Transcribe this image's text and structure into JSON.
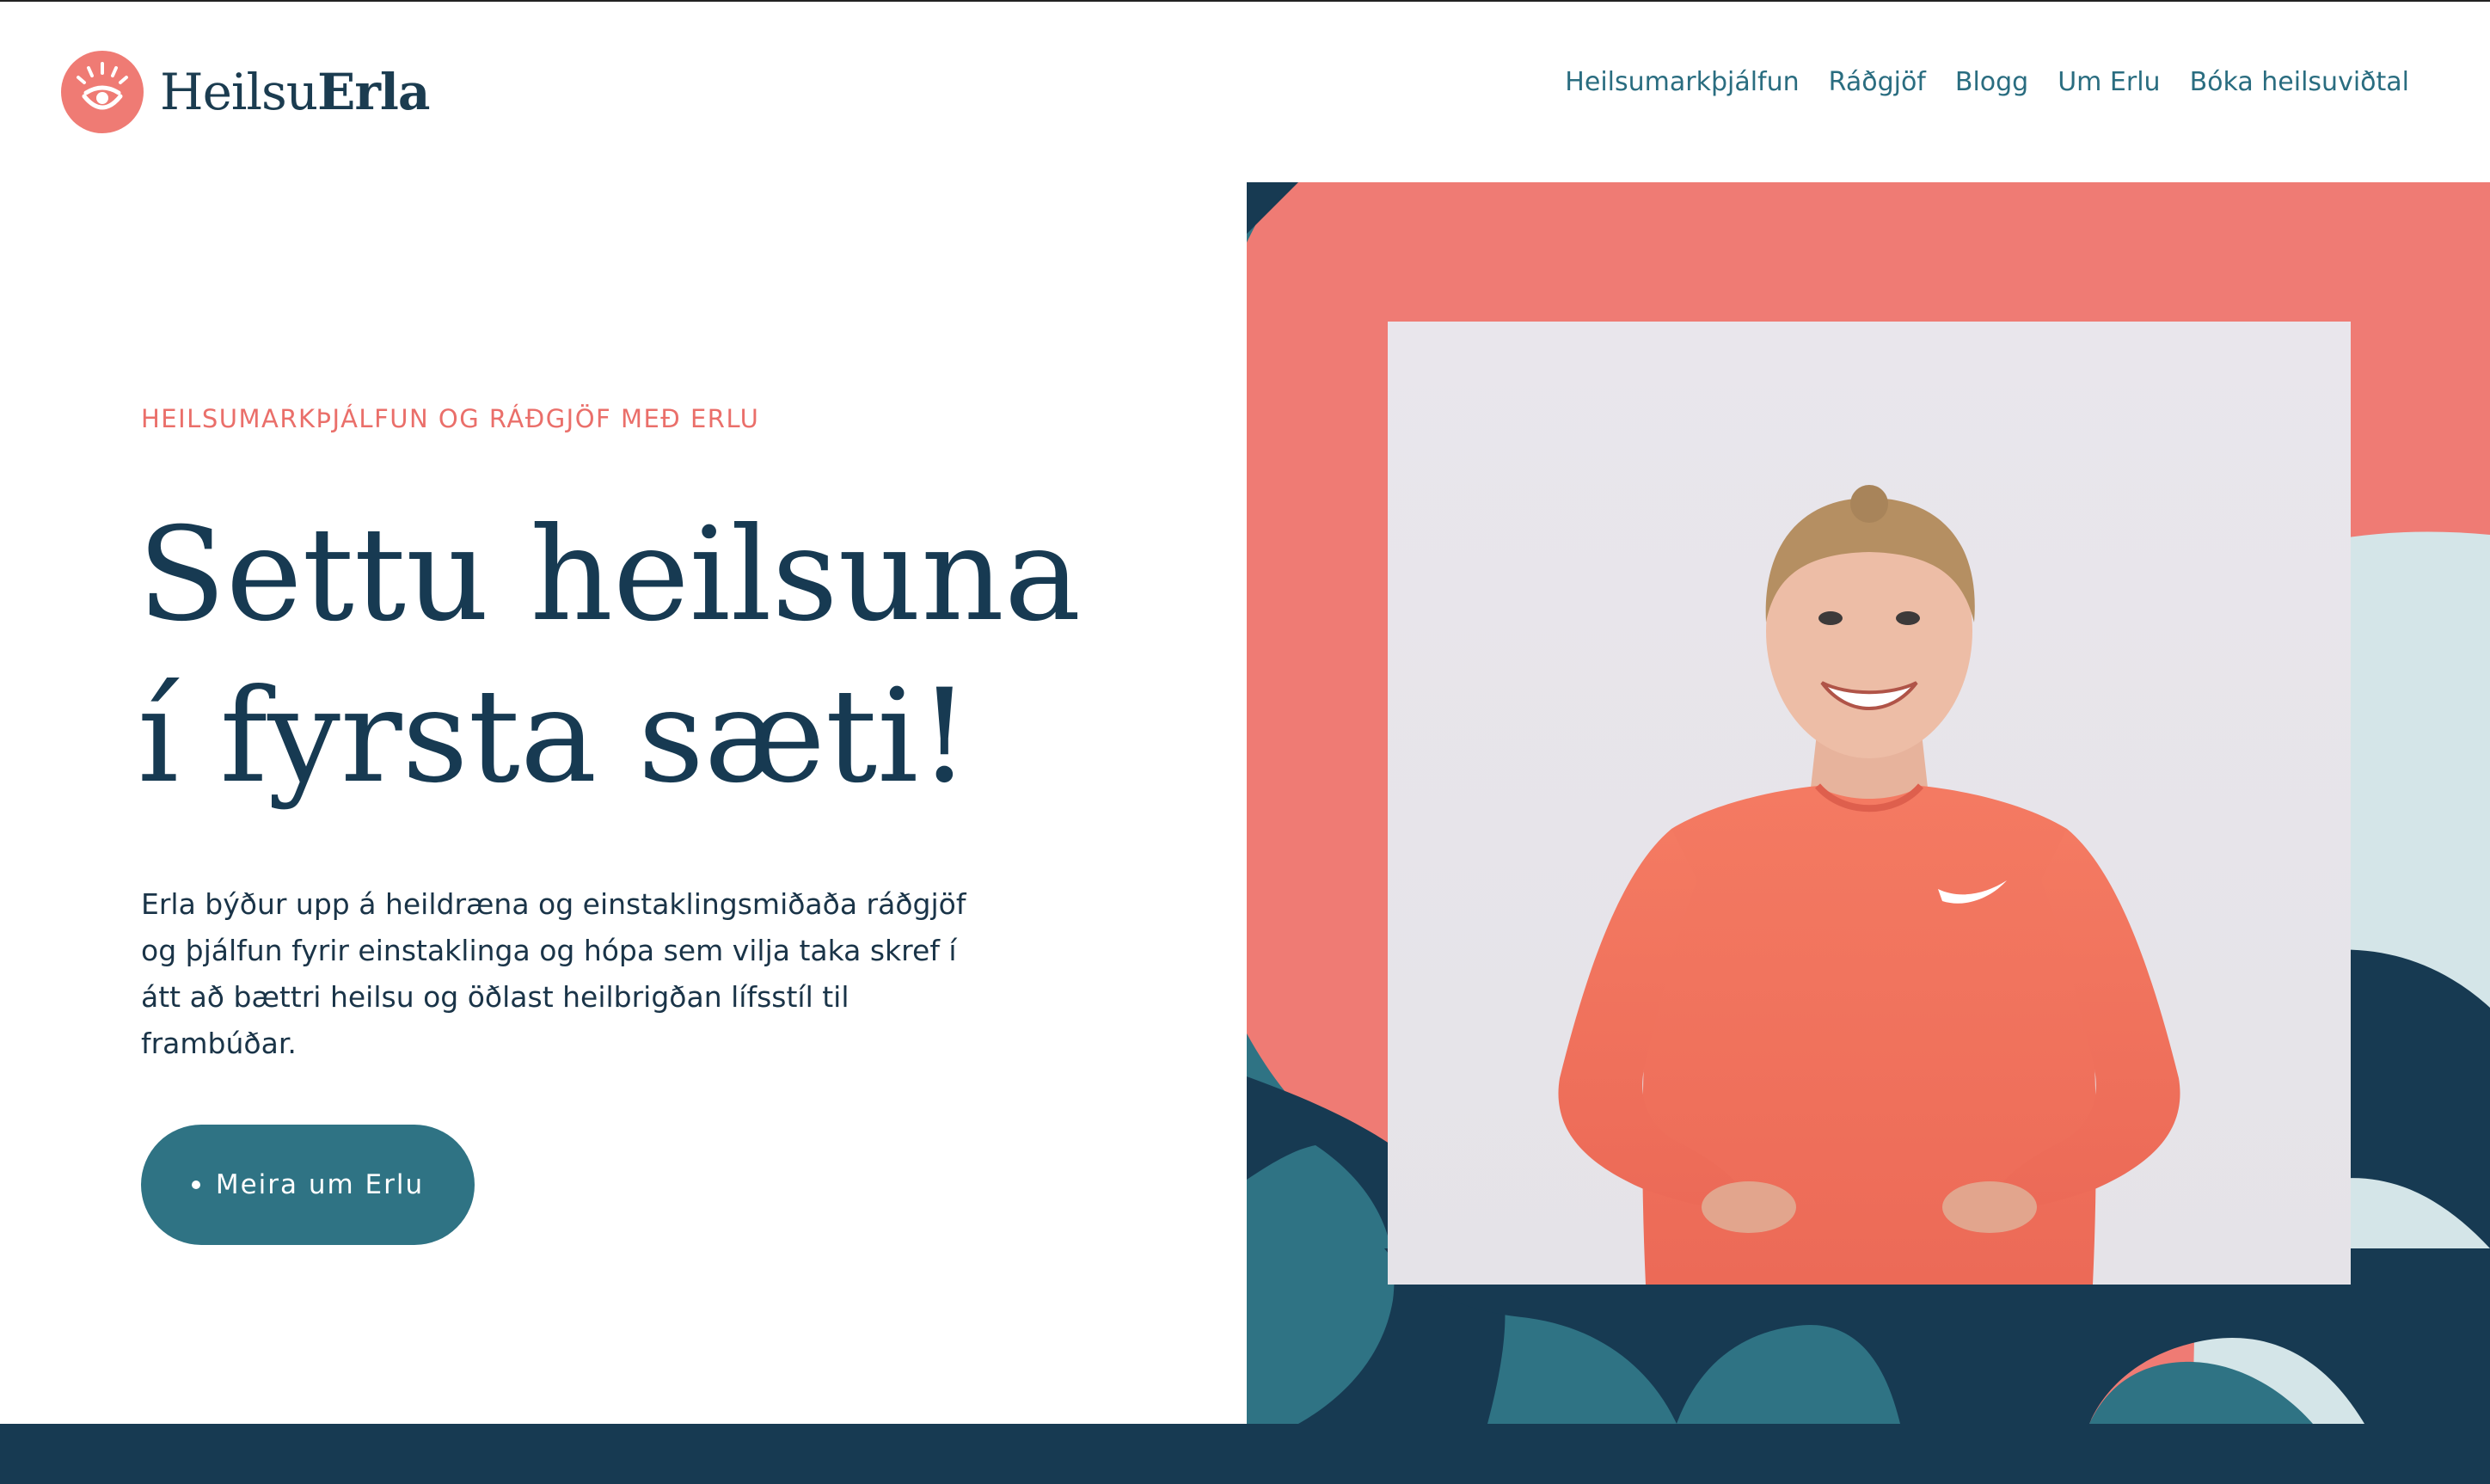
{
  "brand": {
    "logo_light": "Heilsu",
    "logo_bold": "Erla",
    "colors": {
      "coral": "#ef7b74",
      "navy": "#173a52",
      "teal": "#2f7384",
      "light_blue": "#d4e5e8"
    }
  },
  "nav": {
    "items": [
      {
        "label": "Heilsumarkþjálfun"
      },
      {
        "label": "Ráðgjöf"
      },
      {
        "label": "Blogg"
      },
      {
        "label": "Um Erlu"
      },
      {
        "label": "Bóka heilsuviðtal"
      }
    ]
  },
  "hero": {
    "eyebrow": "HEILSUMARKÞJÁLFUN OG RÁÐGJÖF MEÐ ERLU",
    "title_line1": "Settu heilsuna",
    "title_line2": "í fyrsta sæti!",
    "body": "Erla býður upp á heildræna og einstaklingsmiðaða ráðgjöf og þjálfun fyrir einstaklinga og hópa sem vilja taka skref í átt að bættri heilsu og öðlast heilbrigðan lífsstíl til frambúðar.",
    "cta_label": "Meira um Erlu"
  },
  "icons": {
    "logo": "sun-eye-icon",
    "cta_bullet": "dot-icon",
    "shirt_logo": "swoosh-icon"
  }
}
